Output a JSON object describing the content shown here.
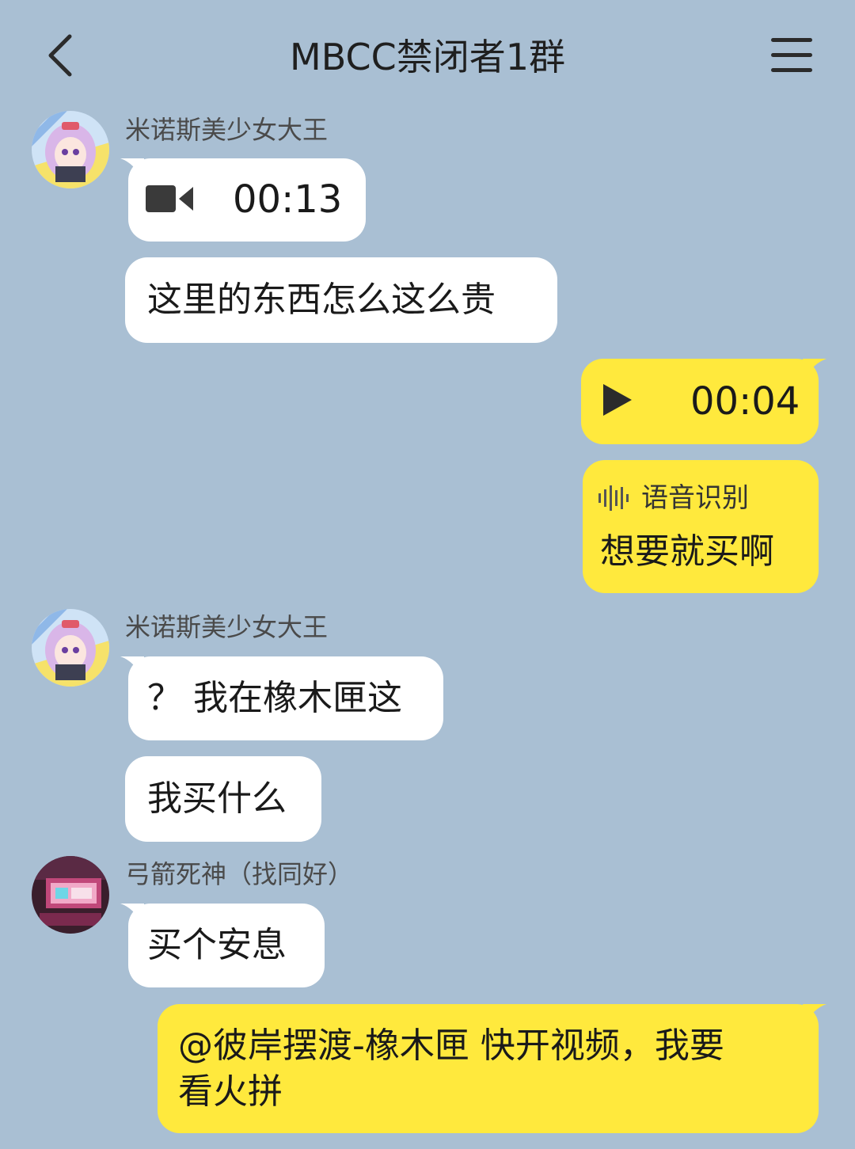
{
  "header": {
    "title": "MBCC禁闭者1群"
  },
  "messages": {
    "m1": {
      "sender": "米诺斯美少女大王",
      "video_duration": "00:13",
      "text2": "这里的东西怎么这么贵"
    },
    "m2": {
      "voice_duration": "00:04",
      "transcript_label": "语音识别",
      "transcript_text": "想要就买啊"
    },
    "m3": {
      "sender": "米诺斯美少女大王",
      "text1": "？ 我在橡木匣这",
      "text2": "我买什么"
    },
    "m4": {
      "sender": "弓箭死神（找同好）",
      "text1": "买个安息"
    },
    "m5": {
      "line1": "@彼岸摆渡-橡木匣 快开视频，我要",
      "line2": "看火拼"
    }
  },
  "colors": {
    "background": "#a9bfd3",
    "self_bubble": "#ffe93d",
    "other_bubble": "#ffffff"
  }
}
